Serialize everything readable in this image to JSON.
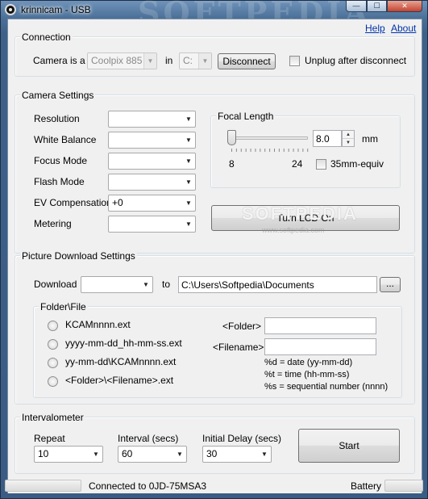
{
  "window": {
    "title": "krinnicam - USB",
    "brand_watermark": "SOFTPEDIA"
  },
  "caption_buttons": {
    "minimize": "—",
    "maximize": "☐",
    "close": "✕"
  },
  "links": {
    "help": "Help",
    "about": "About"
  },
  "connection": {
    "title": "Connection",
    "camera_label": "Camera is a",
    "camera_model": "Coolpix 885",
    "in_label": "in",
    "port_value": "C:",
    "disconnect_label": "Disconnect",
    "unplug_label": "Unplug after disconnect"
  },
  "camera_settings": {
    "title": "Camera Settings",
    "rows": [
      {
        "label": "Resolution",
        "value": ""
      },
      {
        "label": "White Balance",
        "value": ""
      },
      {
        "label": "Focus Mode",
        "value": ""
      },
      {
        "label": "Flash Mode",
        "value": ""
      },
      {
        "label": "EV Compensation",
        "value": "+0"
      },
      {
        "label": "Metering",
        "value": ""
      }
    ],
    "focal": {
      "title": "Focal Length",
      "value": "8.0",
      "unit": "mm",
      "min_label": "8",
      "max_label": "24",
      "slider_fraction": 0.0,
      "equiv_label": "35mm-equiv"
    },
    "lcd_button": "Turn LCD On"
  },
  "download": {
    "title": "Picture Download Settings",
    "download_label": "Download",
    "download_value": "",
    "to_label": "to",
    "path": "C:\\Users\\Softpedia\\Documents",
    "browse_label": "...",
    "folder_file_title": "Folder\\File",
    "options": [
      "KCAMnnnn.ext",
      "yyyy-mm-dd_hh-mm-ss.ext",
      "yy-mm-dd\\KCAMnnnn.ext",
      "<Folder>\\<Filename>.ext"
    ],
    "folder_label": "<Folder>",
    "filename_label": "<Filename>",
    "folder_value": "",
    "filename_value": "",
    "legend": [
      "%d = date (yy-mm-dd)",
      "%t = time (hh-mm-ss)",
      "%s = sequential number (nnnn)"
    ]
  },
  "intervalometer": {
    "title": "Intervalometer",
    "repeat_label": "Repeat",
    "repeat_value": "10",
    "interval_label": "Interval (secs)",
    "interval_value": "60",
    "delay_label": "Initial Delay (secs)",
    "delay_value": "30",
    "start_label": "Start"
  },
  "status": {
    "connected_text": "Connected to 0JD-75MSA3",
    "battery_label": "Battery"
  },
  "icons": {
    "dropdown": "▼",
    "spin_up": "▲",
    "spin_down": "▼"
  },
  "watermark": {
    "big": "SOFTPEDIA",
    "small": "www.softpedia.com"
  }
}
